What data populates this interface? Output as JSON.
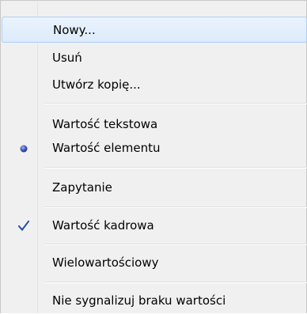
{
  "menu": {
    "items": [
      {
        "label": "Nowy...",
        "highlighted": true,
        "indicator": "none"
      },
      {
        "label": "Usuń",
        "highlighted": false,
        "indicator": "none"
      },
      {
        "label": "Utwórz kopię...",
        "highlighted": false,
        "indicator": "none"
      },
      {
        "label": "Wartość tekstowa",
        "highlighted": false,
        "indicator": "none"
      },
      {
        "label": "Wartość elementu",
        "highlighted": false,
        "indicator": "radio-bullet"
      },
      {
        "label": "Zapytanie",
        "highlighted": false,
        "indicator": "none"
      },
      {
        "label": "Wartość kadrowa",
        "highlighted": false,
        "indicator": "checkmark"
      },
      {
        "label": "Wielowartościowy",
        "highlighted": false,
        "indicator": "none"
      },
      {
        "label": "Nie sygnalizuj braku wartości",
        "highlighted": false,
        "indicator": "none"
      }
    ]
  },
  "colors": {
    "menu_background": "#f0f0f0",
    "highlight_border": "#aecff7",
    "check_color": "#2150a8",
    "radio_color": "#3b4aa8"
  },
  "icons": {
    "radio": "radio-bullet-icon",
    "check": "checkmark-icon"
  }
}
